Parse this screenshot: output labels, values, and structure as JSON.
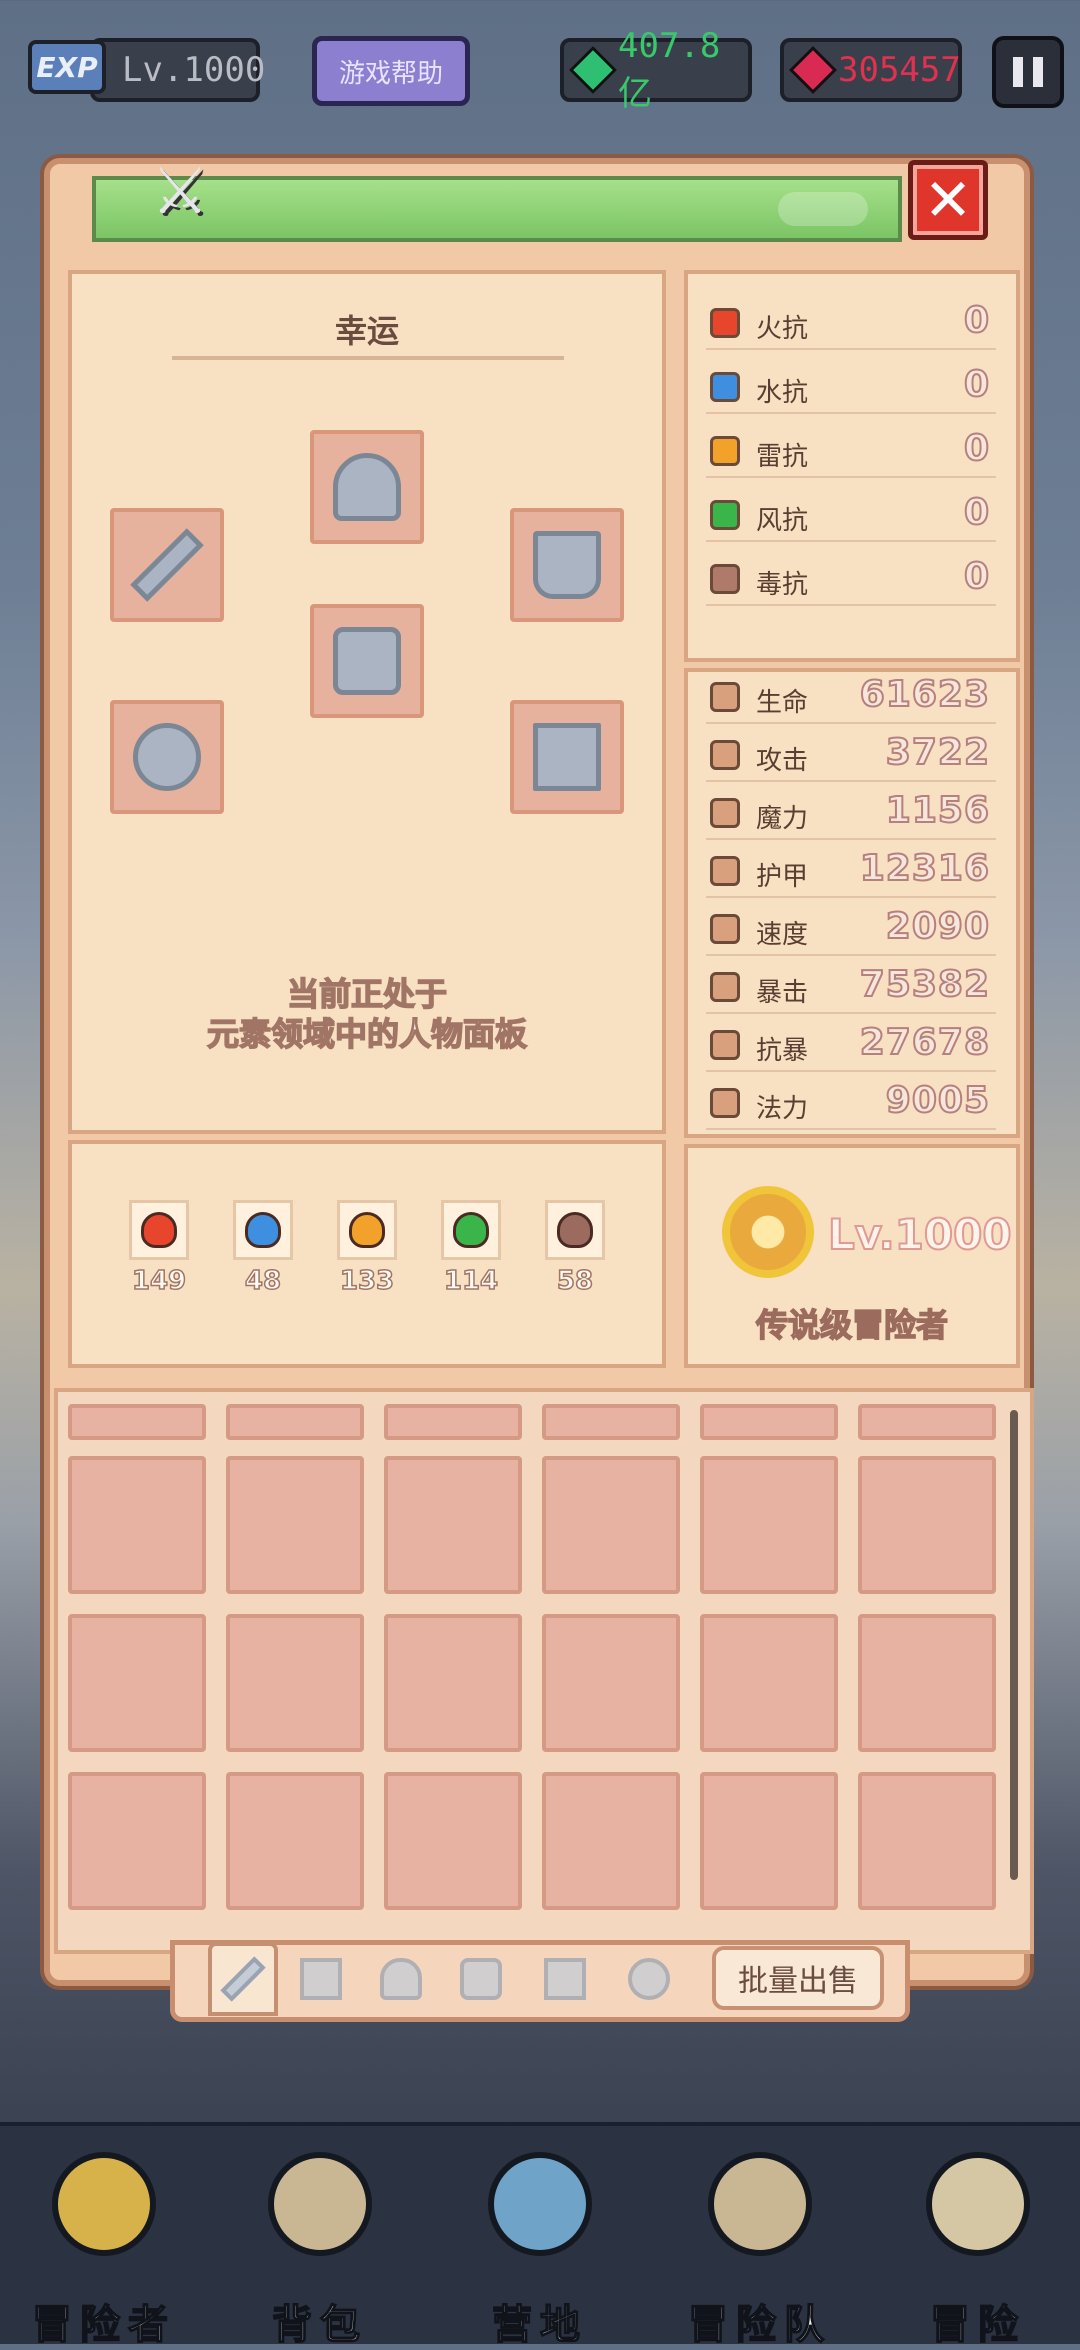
{
  "hud": {
    "exp_badge": "EXP",
    "level": "Lv.1000",
    "help_button": "游戏帮助",
    "green_currency": "407.8亿",
    "red_currency": "305457"
  },
  "character": {
    "title": "幸运",
    "notice_line1": "当前正处于",
    "notice_line2": "元素领域中的人物面板"
  },
  "resistances": [
    {
      "icon": "fire-icon",
      "label": "火抗",
      "value": "0",
      "color": "#e8462c"
    },
    {
      "icon": "water-icon",
      "label": "水抗",
      "value": "0",
      "color": "#3f8fe0"
    },
    {
      "icon": "thunder-icon",
      "label": "雷抗",
      "value": "0",
      "color": "#f2a12b"
    },
    {
      "icon": "wind-icon",
      "label": "风抗",
      "value": "0",
      "color": "#39b54a"
    },
    {
      "icon": "poison-icon",
      "label": "毒抗",
      "value": "0",
      "color": "#b07a6a"
    }
  ],
  "stats": [
    {
      "icon": "heart-icon",
      "label": "生命",
      "value": "61623"
    },
    {
      "icon": "sword-icon",
      "label": "攻击",
      "value": "3722"
    },
    {
      "icon": "staff-icon",
      "label": "魔力",
      "value": "1156"
    },
    {
      "icon": "armor-icon",
      "label": "护甲",
      "value": "12316"
    },
    {
      "icon": "boot-icon",
      "label": "速度",
      "value": "2090"
    },
    {
      "icon": "crit-icon",
      "label": "暴击",
      "value": "75382"
    },
    {
      "icon": "anti-crit-icon",
      "label": "抗暴",
      "value": "27678"
    },
    {
      "icon": "magic-icon",
      "label": "法力",
      "value": "9005"
    }
  ],
  "elements": [
    {
      "icon": "fire-element-icon",
      "value": "149",
      "color": "#e8462c"
    },
    {
      "icon": "water-element-icon",
      "value": "48",
      "color": "#3f8fe0"
    },
    {
      "icon": "thunder-element-icon",
      "value": "133",
      "color": "#f2a12b"
    },
    {
      "icon": "wind-element-icon",
      "value": "114",
      "color": "#39b54a"
    },
    {
      "icon": "skull-element-icon",
      "value": "58",
      "color": "#9b6b60"
    }
  ],
  "rank": {
    "level": "Lv.1000",
    "title": "传说级冒险者"
  },
  "inventory": {
    "bulk_sell": "批量出售"
  },
  "nav": [
    {
      "label": "冒险者",
      "icon": "helmet-icon",
      "color": "#d7b24a"
    },
    {
      "label": "背包",
      "icon": "backpack-icon",
      "color": "#c9b693"
    },
    {
      "label": "营地",
      "icon": "campfire-icon",
      "color": "#6fa3c8"
    },
    {
      "label": "冒险队",
      "icon": "book-icon",
      "color": "#c9b693"
    },
    {
      "label": "冒险",
      "icon": "dagger-icon",
      "color": "#d6c7a4"
    }
  ]
}
